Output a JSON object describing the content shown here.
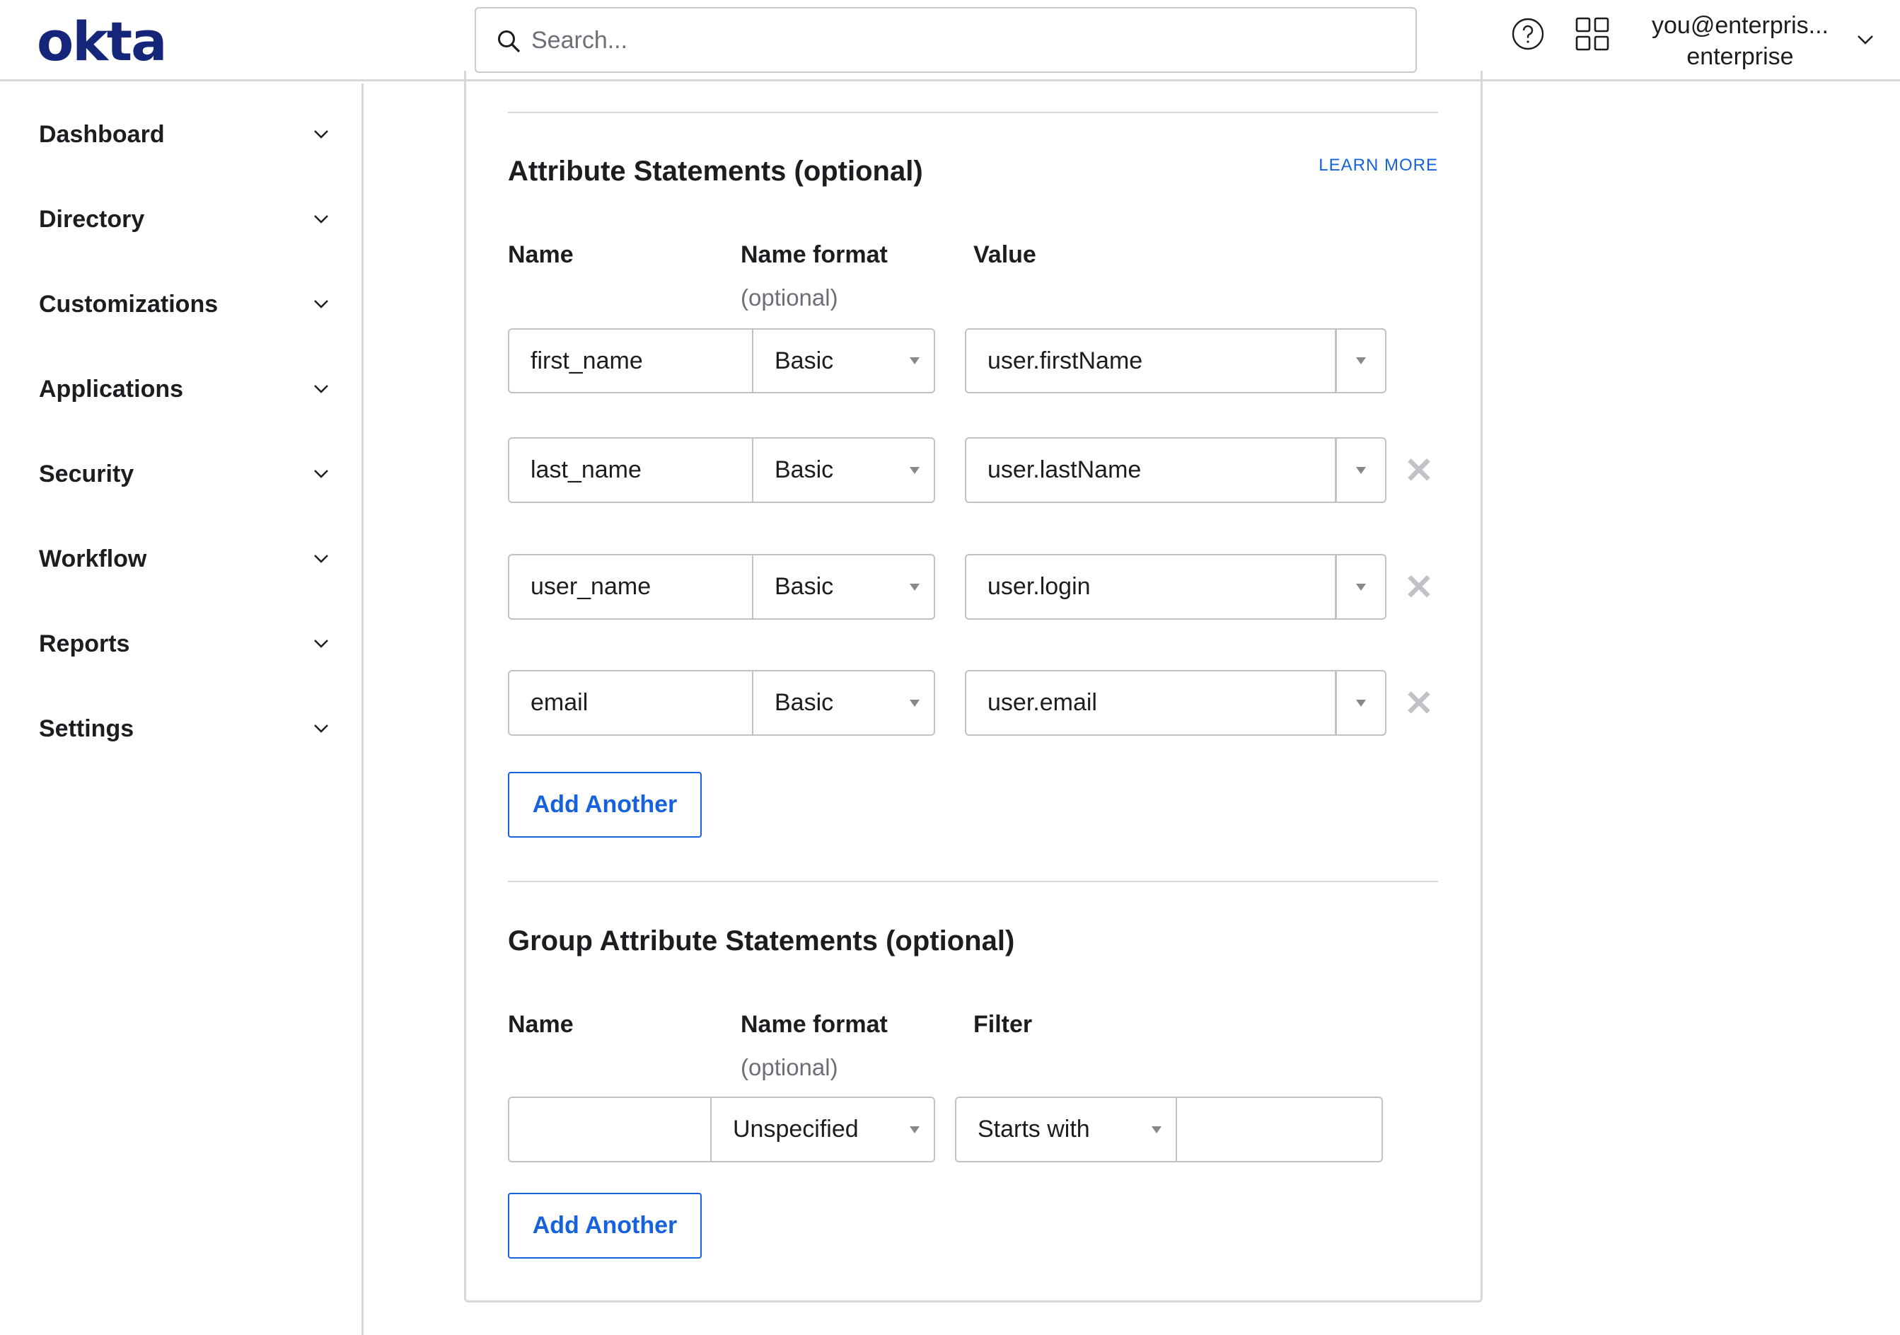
{
  "header": {
    "logo": "okta",
    "search_placeholder": "Search...",
    "user_email": "you@enterpris...",
    "user_org": "enterprise"
  },
  "sidebar": {
    "items": [
      {
        "label": "Dashboard"
      },
      {
        "label": "Directory"
      },
      {
        "label": "Customizations"
      },
      {
        "label": "Applications"
      },
      {
        "label": "Security"
      },
      {
        "label": "Workflow"
      },
      {
        "label": "Reports"
      },
      {
        "label": "Settings"
      }
    ]
  },
  "attributes": {
    "title": "Attribute Statements (optional)",
    "learn_more": "LEARN MORE",
    "col_name": "Name",
    "col_format": "Name format",
    "col_format_optional": "(optional)",
    "col_value": "Value",
    "rows": [
      {
        "name": "first_name",
        "format": "Basic",
        "value": "user.firstName"
      },
      {
        "name": "last_name",
        "format": "Basic",
        "value": "user.lastName"
      },
      {
        "name": "user_name",
        "format": "Basic",
        "value": "user.login"
      },
      {
        "name": "email",
        "format": "Basic",
        "value": "user.email"
      }
    ],
    "add_another": "Add Another"
  },
  "group_attributes": {
    "title": "Group Attribute Statements (optional)",
    "col_name": "Name",
    "col_format": "Name format",
    "col_format_optional": "(optional)",
    "col_filter": "Filter",
    "row": {
      "name": "",
      "format": "Unspecified",
      "filter_type": "Starts with",
      "filter_value": ""
    },
    "add_another": "Add Another"
  },
  "colors": {
    "brand": "#14257a",
    "accent": "#1662dd",
    "border": "#c1c1c8"
  }
}
